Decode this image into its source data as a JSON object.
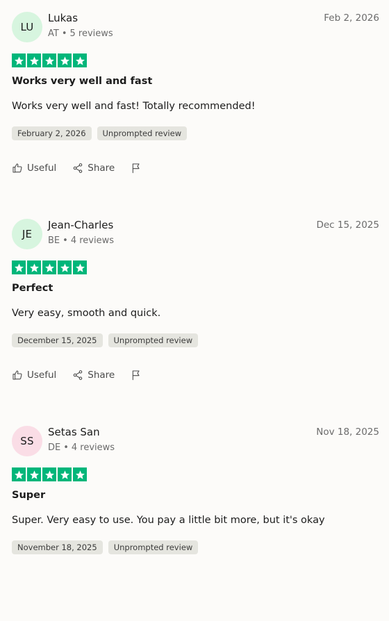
{
  "colors": {
    "background": "#fcfbf9",
    "star_green": "#00b67a",
    "tag_background": "#e5e5df",
    "avatar_green": "#d7f5df",
    "avatar_pink": "#fadde6"
  },
  "actions": {
    "useful_label": "Useful",
    "share_label": "Share",
    "flag_icon": "flag-icon"
  },
  "reviews": [
    {
      "initials": "LU",
      "avatar_color": "#d7f5df",
      "name": "Lukas",
      "country": "AT",
      "review_count": "5 reviews",
      "date": "Feb 2, 2026",
      "rating": 5,
      "title": "Works very well and fast",
      "text": "Works very well and fast! Totally recommended!",
      "tags": [
        "February 2, 2026",
        "Unprompted review"
      ]
    },
    {
      "initials": "JE",
      "avatar_color": "#d7f5df",
      "name": "Jean-Charles",
      "country": "BE",
      "review_count": "4 reviews",
      "date": "Dec 15, 2025",
      "rating": 5,
      "title": "Perfect",
      "text": "Very easy, smooth and quick.",
      "tags": [
        "December 15, 2025",
        "Unprompted review"
      ]
    },
    {
      "initials": "SS",
      "avatar_color": "#fadde6",
      "name": "Setas San",
      "country": "DE",
      "review_count": "4 reviews",
      "date": "Nov 18, 2025",
      "rating": 5,
      "title": "Super",
      "text": "Super. Very easy to use. You pay a little bit more, but it's okay",
      "tags": [
        "November 18, 2025",
        "Unprompted review"
      ]
    }
  ]
}
